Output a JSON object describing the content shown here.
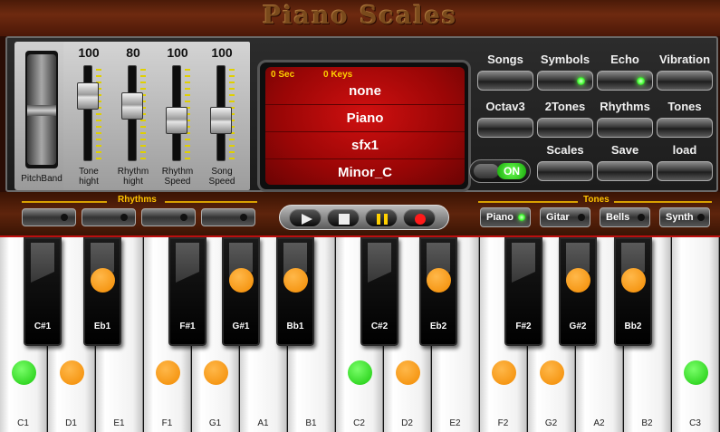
{
  "app": {
    "title": "Piano Scales"
  },
  "pitchband": {
    "label": "PitchBand"
  },
  "sliders": [
    {
      "value": "100",
      "label": "Tone hight",
      "level": 0.75
    },
    {
      "value": "80",
      "label": "Rhythm hight",
      "level": 0.6
    },
    {
      "value": "100",
      "label": "Rhythm Speed",
      "level": 0.4
    },
    {
      "value": "100",
      "label": "Song Speed",
      "level": 0.4
    }
  ],
  "display": {
    "time": "0 Sec",
    "keys": "0 Keys",
    "rows": [
      "none",
      "Piano",
      "sfx1",
      "Minor_C"
    ]
  },
  "controls": {
    "songs": "Songs",
    "symbols": "Symbols",
    "echo": "Echo",
    "vibration": "Vibration",
    "octav3": "Octav3",
    "twotones": "2Tones",
    "rhythms": "Rhythms",
    "tones": "Tones",
    "on": "ON",
    "scales": "Scales",
    "save": "Save",
    "load": "load"
  },
  "strip": {
    "rhythms_label": "Rhythms",
    "tones_label": "Tones",
    "tone_buttons": [
      "Piano",
      "Gitar",
      "Bells",
      "Synth"
    ]
  },
  "keyboard": {
    "white_keys": [
      "C1",
      "D1",
      "E1",
      "F1",
      "G1",
      "A1",
      "B1",
      "C2",
      "D2",
      "E2",
      "F2",
      "G2",
      "A2",
      "B2",
      "C3"
    ],
    "black_keys": [
      "C#1",
      "Eb1",
      "F#1",
      "G#1",
      "Bb1",
      "C#2",
      "Eb2",
      "F#2",
      "G#2",
      "Bb2"
    ],
    "white_marks": [
      "green",
      "orange",
      "",
      "orange",
      "orange",
      "",
      "",
      "green",
      "orange",
      "",
      "orange",
      "orange",
      "",
      "",
      "green"
    ],
    "black_marks": [
      "",
      "orange",
      "",
      "orange",
      "orange",
      "",
      "orange",
      "",
      "orange",
      "orange"
    ],
    "colors": {
      "orange": "#f28a00",
      "green": "#18c80a"
    }
  }
}
